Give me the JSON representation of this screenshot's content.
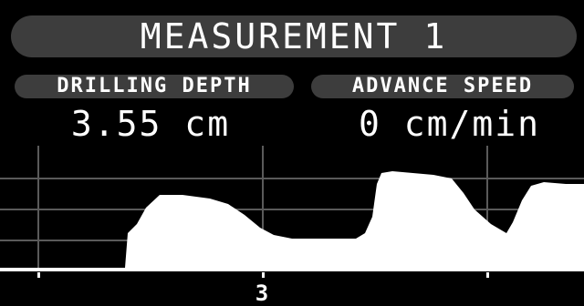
{
  "header": {
    "title": "MEASUREMENT 1"
  },
  "metrics": {
    "drilling_depth": {
      "label": "DRILLING DEPTH",
      "value": "3.55 cm"
    },
    "advance_speed": {
      "label": "ADVANCE SPEED",
      "value": "0 cm/min"
    }
  },
  "graph": {
    "x_marker_label": "3"
  },
  "colors": {
    "background": "#000000",
    "pill": "#3d3d3d",
    "foreground": "#ffffff",
    "grid": "#5a5a5a"
  }
}
